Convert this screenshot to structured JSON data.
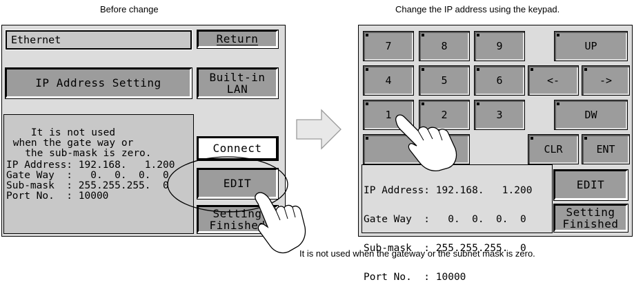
{
  "captions": {
    "before": "Before change",
    "after": "Change the IP address using the keypad.",
    "note": "It is not used when the gateway or the subnet mask is zero."
  },
  "left_screen": {
    "title_field": "Ethernet",
    "return_button": "Return",
    "ip_setting_button": "IP Address Setting",
    "builtin_lan_line1": "Built-in",
    "builtin_lan_line2": "LAN",
    "info_text": "It is not used\n when the gate way or\n   the sub-mask is zero.",
    "connect_button": "Connect",
    "ip_address_line": "IP Address: 192.168.   1.200",
    "gateway_line": "Gate Way  :   0.  0.  0.  0",
    "submask_line": "Sub-mask  : 255.255.255.  0",
    "port_line": "Port No.  : 10000",
    "edit_button": "EDIT",
    "setting_finished_line1": "Setting",
    "setting_finished_line2": "Finished"
  },
  "right_screen": {
    "keys": {
      "k7": "7",
      "k8": "8",
      "k9": "9",
      "up": "UP",
      "k4": "4",
      "k5": "5",
      "k6": "6",
      "left": "<-",
      "right": "->",
      "k1": "1",
      "k2": "2",
      "k3": "3",
      "dw": "DW",
      "clr": "CLR",
      "ent": "ENT"
    },
    "ip_address_line": "IP Address: 192.168.   1.200",
    "gateway_line": "Gate Way  :   0.  0.  0.  0",
    "submask_line": "Sub-mask  : 255.255.255.  0",
    "port_line": "Port No.  : 10000",
    "edit_button": "EDIT",
    "setting_finished_line1": "Setting",
    "setting_finished_line2": "Finished"
  },
  "icons": {
    "arrow": "right-arrow-icon",
    "hand_left": "pointing-hand-icon",
    "hand_right": "pointing-hand-icon"
  },
  "colors": {
    "screen_bg": "#dcdcdc",
    "button_gray": "#9c9c9c",
    "arrow_fill": "#e8e8e8"
  }
}
